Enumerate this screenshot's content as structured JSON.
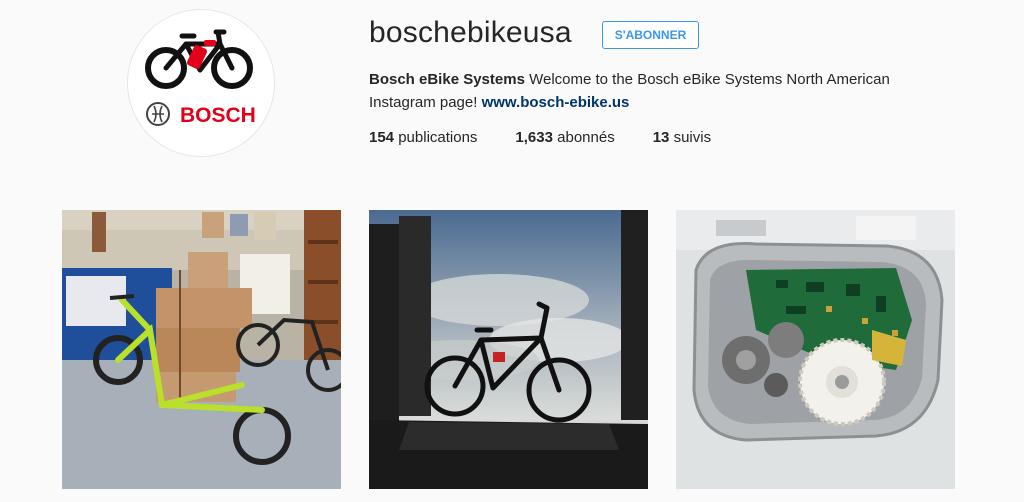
{
  "profile": {
    "username": "boschebikeusa",
    "follow_label": "S'ABONNER",
    "display_name": "Bosch eBike Systems",
    "bio_text": " Welcome to the Bosch eBike Systems North American Instagram page! ",
    "website": "www.bosch-ebike.us",
    "logo_text": "BOSCH",
    "accent_color": "#3897f0",
    "brand_red": "#e2001a"
  },
  "stats": {
    "posts_count": "154",
    "posts_label": "publications",
    "followers_count": "1,633",
    "followers_label": "abonnés",
    "following_count": "13",
    "following_label": "suivis"
  },
  "posts": [
    {
      "icon": "cargo-bike-shop-photo"
    },
    {
      "icon": "bike-silhouette-sky-photo"
    },
    {
      "icon": "motor-circuit-board-photo"
    }
  ]
}
